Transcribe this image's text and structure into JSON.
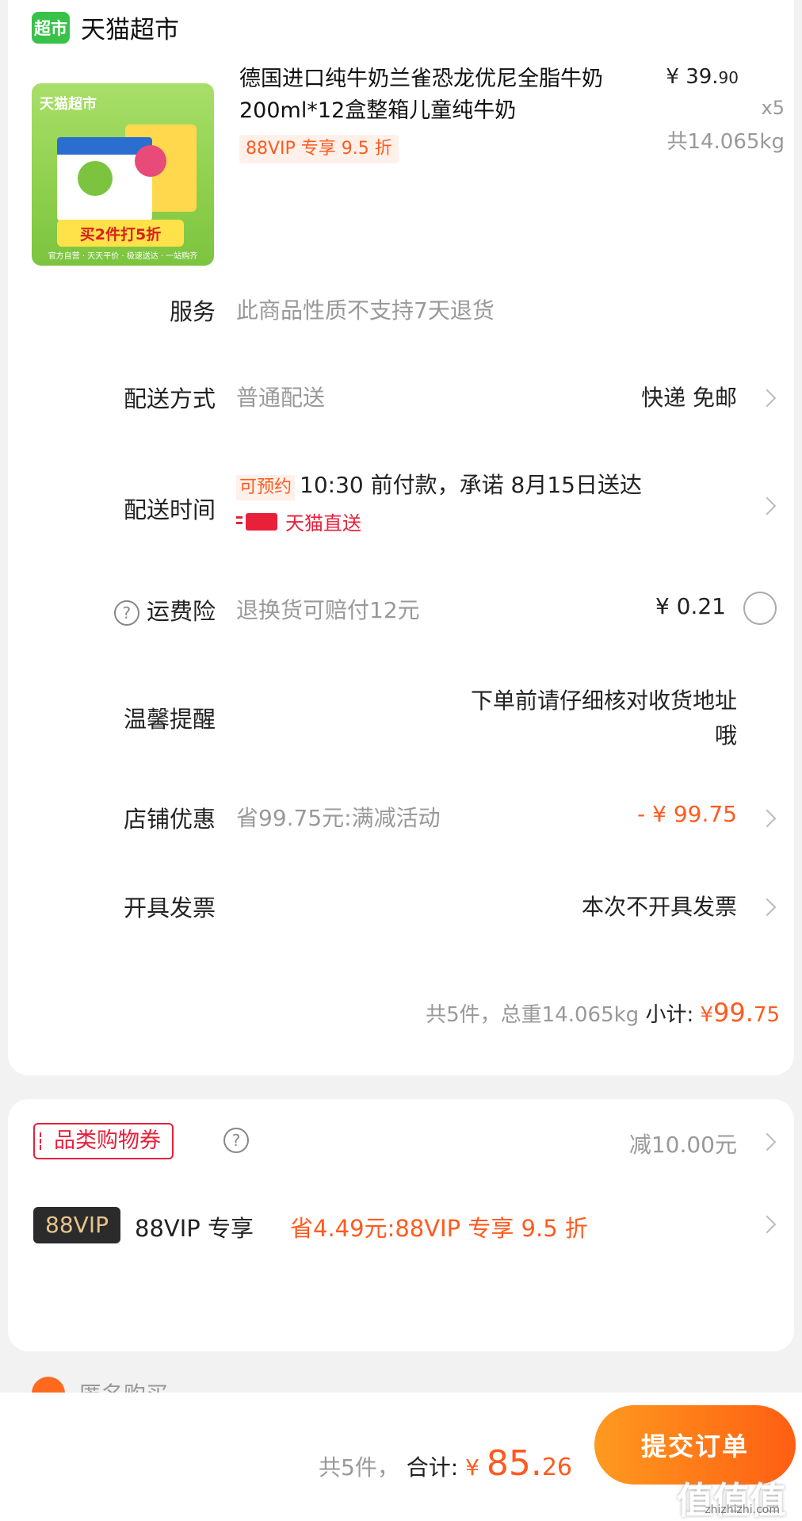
{
  "store": {
    "logo_text": "超市",
    "name": "天猫超市"
  },
  "product": {
    "image_brand": "天猫超市",
    "image_banner": "买2件打5折",
    "image_footer": "官方自营 · 天天平价 · 极速送达 · 一站购齐",
    "title": "德国进口纯牛奶兰雀恐龙优尼全脂牛奶200ml*12盒整箱儿童纯牛奶",
    "tag": "88VIP 专享 9.5 折",
    "price_int": "¥ 39.",
    "price_dec": "90",
    "qty": "x5",
    "weight": "共14.065kg"
  },
  "rows": {
    "service": {
      "label": "服务",
      "value": "此商品性质不支持7天退货"
    },
    "delivery_method": {
      "label": "配送方式",
      "value": "普通配送",
      "right": "快递 免邮"
    },
    "delivery_time": {
      "label": "配送时间",
      "tag": "可预约",
      "value": "10:30 前付款，承诺 8月15日送达",
      "direct": "天猫直送"
    },
    "freight_insurance": {
      "label": "运费险",
      "help": "?",
      "value": "退换货可赔付12元",
      "right": "¥ 0.21"
    },
    "reminder": {
      "label": "温馨提醒",
      "value_line1": "下单前请仔细核对收货地址",
      "value_line2": "哦"
    },
    "shop_discount": {
      "label": "店铺优惠",
      "value": "省99.75元:满减活动",
      "right": "- ¥ 99.75"
    },
    "invoice": {
      "label": "开具发票",
      "right": "本次不开具发票"
    }
  },
  "subtotal": {
    "summary": "共5件，总重14.065kg",
    "label": "小计:",
    "currency": "¥",
    "int": "99.",
    "dec": "75"
  },
  "coupon": {
    "tag": "品类购物券",
    "help": "?",
    "right": "减10.00元"
  },
  "vip": {
    "badge": "88VIP",
    "label": "88VIP 专享",
    "value": "省4.49元:88VIP 专享 9.5 折"
  },
  "hidden_row": {
    "text": "匿名购买"
  },
  "bottom": {
    "count": "共5件，",
    "label": "合计:",
    "currency": "¥ ",
    "int": "85.",
    "dec": "26",
    "submit": "提交订单",
    "watermark": "值值值",
    "watermark_url": "zhizhizhi.com"
  },
  "colors": {
    "accent": "#ff5a1f",
    "brand_green": "#39c24a",
    "danger": "#e8203a"
  }
}
